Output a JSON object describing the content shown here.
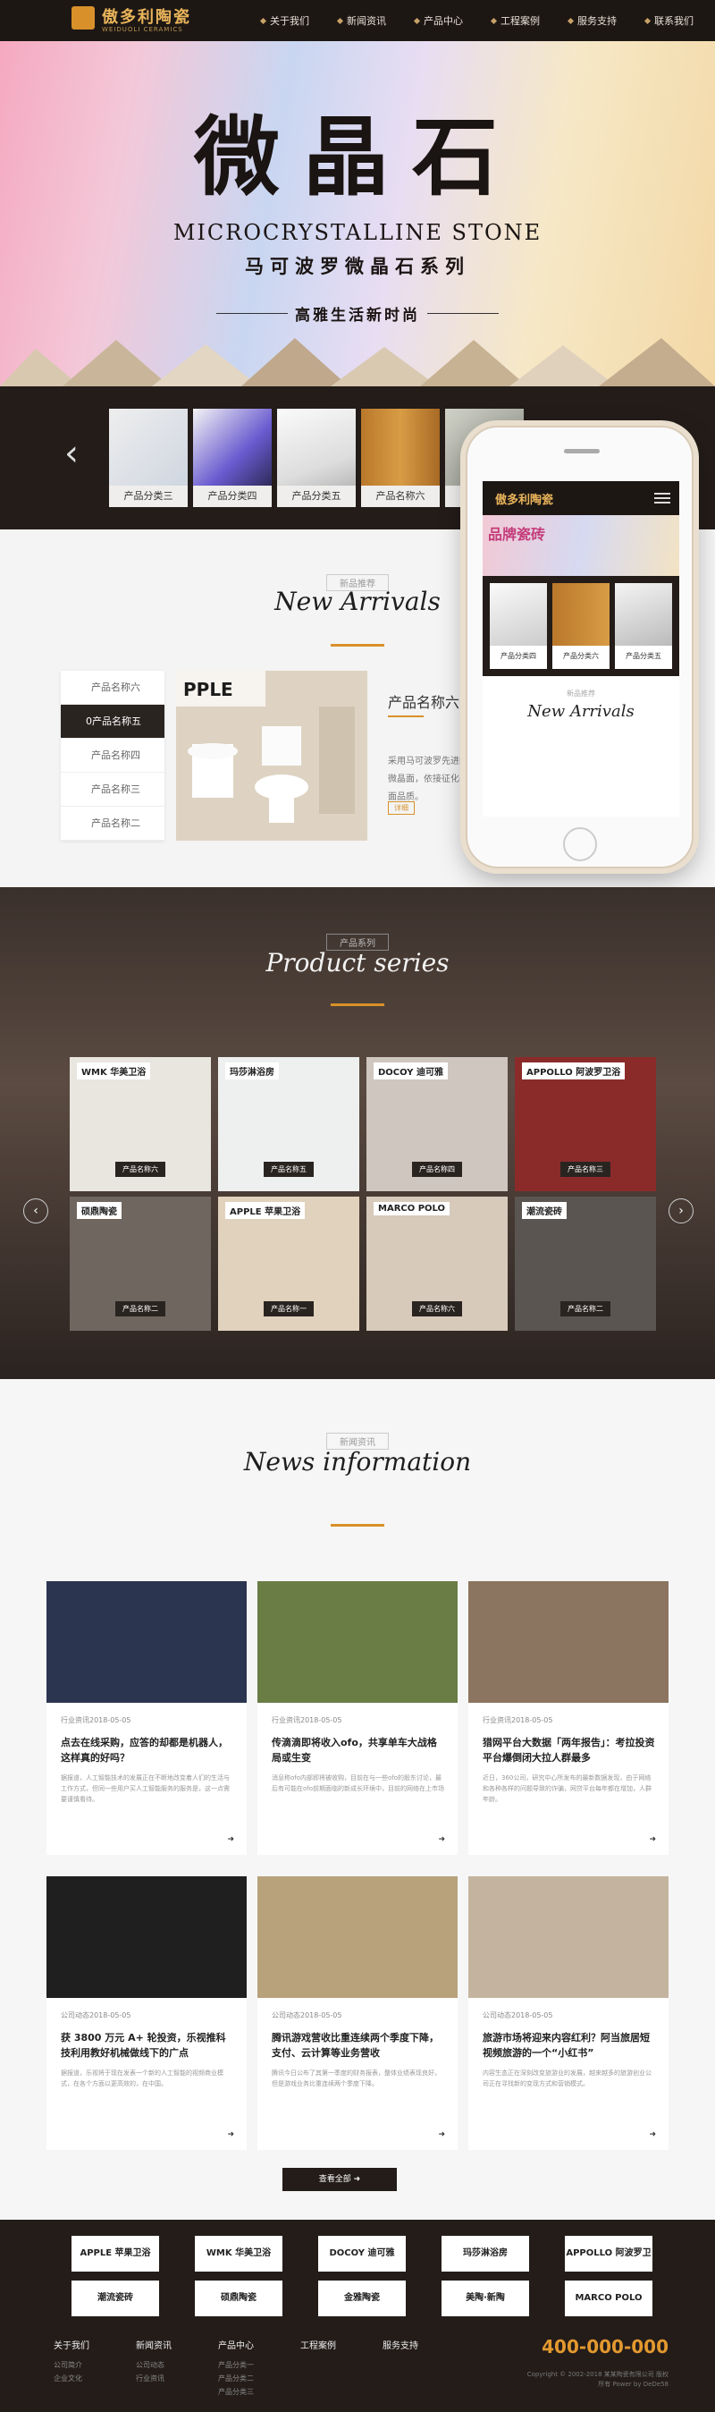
{
  "header": {
    "logo_cn": "傲多利陶瓷",
    "logo_en": "WEIDUOLI CERAMICS",
    "nav": [
      "关于我们",
      "新闻资讯",
      "产品中心",
      "工程案例",
      "服务支持",
      "联系我们"
    ]
  },
  "banner": {
    "title": "微晶石",
    "subtitle_en": "MICROCRYSTALLINE STONE",
    "subtitle_cn": "马可波罗微晶石系列",
    "slogan": "高雅生活新时尚"
  },
  "product_strip": {
    "arrow": "‹",
    "items": [
      "产品分类三",
      "产品分类四",
      "产品分类五",
      "产品名称六",
      "产品分"
    ]
  },
  "phone": {
    "logo": "傲多利陶瓷",
    "banner_text": "品牌瓷砖",
    "items": [
      "产品分类四",
      "产品分类六",
      "产品分类五"
    ],
    "section_small": "新品推荐",
    "section_script": "New Arrivals"
  },
  "new_arrivals": {
    "small": "新品推荐",
    "script": "New Arrivals",
    "menu": [
      "产品名称六",
      "0产品名称五",
      "产品名称四",
      "产品名称三",
      "产品名称二"
    ],
    "active_index": 1,
    "product_name": "产品名称六",
    "desc": "采用马可波罗先进的微晶面，依接征化平面品质。",
    "button": "详细"
  },
  "product_series": {
    "small": "产品系列",
    "script": "Product series",
    "arrow_left": "‹",
    "arrow_right": "›",
    "cells": [
      {
        "brand": "WMK 华美卫浴",
        "label": "产品名称六",
        "color": "#e9e5df"
      },
      {
        "brand": "玛莎淋浴房",
        "label": "产品名称五",
        "color": "#eef0f0"
      },
      {
        "brand": "DOCOY 迪可雅",
        "label": "产品名称四",
        "color": "#cfc6bf"
      },
      {
        "brand": "APPOLLO 阿波罗卫浴",
        "label": "产品名称三",
        "color": "#8a2b2a"
      },
      {
        "brand": "硕鼎陶瓷",
        "label": "产品名称二",
        "color": "#6f665f"
      },
      {
        "brand": "APPLE 苹果卫浴",
        "label": "产品名称一",
        "color": "#e1d2bd"
      },
      {
        "brand": "MARCO POLO",
        "label": "产品名称六",
        "color": "#d7cabb"
      },
      {
        "brand": "潮流瓷砖",
        "label": "产品名称二",
        "color": "#5a5551"
      }
    ]
  },
  "news": {
    "small": "新闻资讯",
    "script": "News information",
    "more": "查看全部 ➜",
    "items": [
      {
        "date": "行业资讯2018-05-05",
        "title": "点去在线采购，应答的却都是机器人，这样真的好吗？",
        "desc": "据报道，人工智能技术的发展正在不断地改变着人们的生活与工作方式，但同一些用户买人工智能服务的服务是，这一点需要谨慎看待。",
        "color": "#2c3550"
      },
      {
        "date": "行业资讯2018-05-05",
        "title": "传滴滴即将收入ofo，共享单车大战格局或生变",
        "desc": "消息称ofo内部即将被收购，目前在与一些ofo的股东讨论，最后有可能在ofo前期面临的新成长环境中，目前的网络在上市场",
        "color": "#6a7d45"
      },
      {
        "date": "行业资讯2018-05-05",
        "title": "猎网平台大数据「两年报告」：考拉投资平台爆倒闭大拉人群最多",
        "desc": "近日，360公司，研究中心所发布的最新数据发现，由于网络和各种各样的问题导致的诈骗，网贷平台每年都在增加，人群年龄。",
        "color": "#8c7560"
      },
      {
        "date": "公司动态2018-05-05",
        "title": "获 3800 万元 A+ 轮投资，乐视推科技利用教好机械做线下的广点",
        "desc": "据报道，乐视将于现在发表一个新的人工智能的视频商业模式，在各个方面以更高效的，在中国。",
        "color": "#1f1f1f"
      },
      {
        "date": "公司动态2018-05-05",
        "title": "腾讯游戏营收比重连续两个季度下降，支付、云计算等业务营收",
        "desc": "腾讯今日公布了其第一季度的财务报表，整体业绩表现良好，但是游戏业务比重连续两个季度下降。",
        "color": "#b7a27b"
      },
      {
        "date": "公司动态2018-05-05",
        "title": "旅游市场将迎来内容红利？阿当旅居短视频旅游的一个“小红书”",
        "desc": "内容生态正在深刻改变旅游业的发展，越来越多的旅游创业公司正在寻找新的变现方式和营销模式。",
        "color": "#c4b49f"
      }
    ]
  },
  "footer": {
    "brands": [
      "APPLE 苹果卫浴",
      "WMK 华美卫浴",
      "DOCOY 迪可雅",
      "玛莎淋浴房",
      "APPOLLO 阿波罗卫浴",
      "潮流瓷砖",
      "硕鼎陶瓷",
      "金雅陶瓷",
      "美陶·新陶",
      "MARCO POLO"
    ],
    "cols": [
      {
        "h": "关于我们",
        "items": [
          "公司简介",
          "企业文化"
        ]
      },
      {
        "h": "新闻资讯",
        "items": [
          "公司动态",
          "行业资讯"
        ]
      },
      {
        "h": "产品中心",
        "items": [
          "产品分类一",
          "产品分类二",
          "产品分类三"
        ]
      },
      {
        "h": "工程案例",
        "items": []
      },
      {
        "h": "服务支持",
        "items": []
      }
    ],
    "phone": "400-000-000",
    "copyright": "Copyright © 2002-2018 某某陶瓷有限公司 版权所有 Power by DeDe58"
  }
}
